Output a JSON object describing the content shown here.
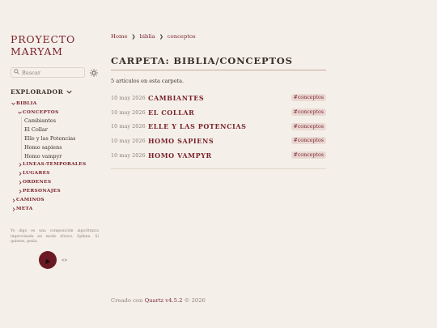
{
  "site": {
    "title_line1": "PROYECTO",
    "title_line2": "MARYAM"
  },
  "search": {
    "placeholder": "Buscar",
    "icon": "search-icon"
  },
  "theme": {
    "icon": "sun-icon"
  },
  "explorer": {
    "label": "EXPLORADOR",
    "root": {
      "label": "BIBLIA"
    },
    "conceptos": {
      "label": "CONCEPTOS",
      "files": [
        "Cambiantes",
        "El Collar",
        "Elle y las Potencias",
        "Homo sapiens",
        "Homo vampyr"
      ]
    },
    "biblia_folders": [
      "LINEAS-TEMPORALES",
      "LUGARES",
      "ORDENES",
      "PERSONAJES"
    ],
    "top_folders": [
      "CAMINOS",
      "META"
    ]
  },
  "note": "Yo digo es una composición algorítmica improvisada en modo dórico. Sphinx. Si quieres, pesla.",
  "breadcrumb": {
    "home": "Home",
    "biblia": "biblia",
    "conceptos": "conceptos",
    "separator": "❯"
  },
  "page": {
    "title": "CARPETA: BIBLIA/CONCEPTOS",
    "count": "5 artículos en esta carpeta.",
    "items": [
      {
        "date": "10 may 2026",
        "title": "CAMBIANTES",
        "tag": "#conceptos"
      },
      {
        "date": "10 may 2026",
        "title": "EL COLLAR",
        "tag": "#conceptos"
      },
      {
        "date": "10 may 2026",
        "title": "ELLE Y LAS POTENCIAS",
        "tag": "#conceptos"
      },
      {
        "date": "10 may 2026",
        "title": "HOMO SAPIENS",
        "tag": "#conceptos"
      },
      {
        "date": "10 may 2026",
        "title": "HOMO VAMPYR",
        "tag": "#conceptos"
      }
    ]
  },
  "footer": {
    "prefix": "Creado con",
    "link": "Quartz v4.5.2",
    "suffix": "© 2026"
  },
  "colors": {
    "accent": "#7a1f2b",
    "background": "#f4f0e9",
    "tag_bg": "#ead9d3",
    "play": "#6b1a25"
  }
}
